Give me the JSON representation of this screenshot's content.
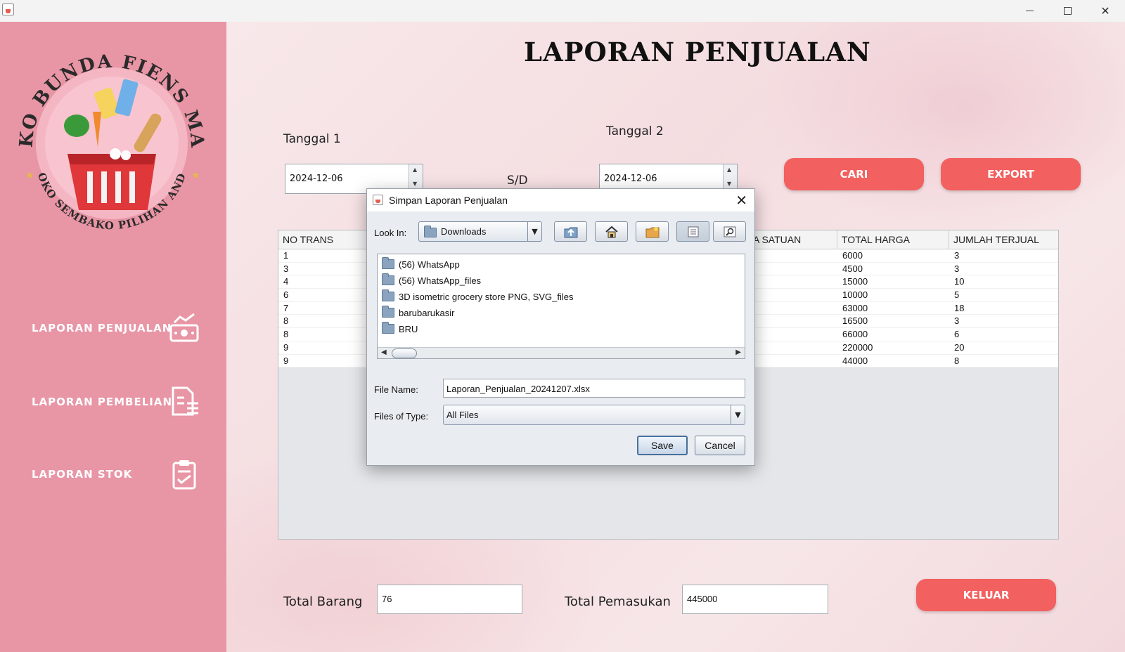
{
  "window": {
    "minimize_label": "—",
    "maximize_label": "□",
    "close_label": "✕"
  },
  "sidebar": {
    "logo_top_text": "TOKO BUNDA FIENS MART",
    "logo_bottom_text": "TOKO SEMBAKO PILIHAN ANDA",
    "items": [
      {
        "label": "LAPORAN PENJUALAN",
        "icon": "money-chart-icon"
      },
      {
        "label": "LAPORAN PEMBELIAN",
        "icon": "document-list-icon"
      },
      {
        "label": "LAPORAN STOK",
        "icon": "clipboard-check-icon"
      }
    ]
  },
  "main": {
    "title": "LAPORAN PENJUALAN",
    "date1_label": "Tanggal 1",
    "date1_value": "2024-12-06",
    "range_label": "S/D",
    "date2_label": "Tanggal 2",
    "date2_value": "2024-12-06",
    "search_button": "CARI",
    "export_button": "EXPORT",
    "exit_button": "KELUAR",
    "total_items_label": "Total Barang",
    "total_items_value": "76",
    "total_income_label": "Total Pemasukan",
    "total_income_value": "445000",
    "accent_color": "#f2605f"
  },
  "table": {
    "columns": [
      "NO TRANS",
      "A SATUAN",
      "TOTAL HARGA",
      "JUMLAH TERJUAL"
    ],
    "rows": [
      [
        "1",
        "6000",
        "3"
      ],
      [
        "3",
        "4500",
        "3"
      ],
      [
        "4",
        "15000",
        "10"
      ],
      [
        "6",
        "10000",
        "5"
      ],
      [
        "7",
        "63000",
        "18"
      ],
      [
        "8",
        "16500",
        "3"
      ],
      [
        "8",
        "66000",
        "6"
      ],
      [
        "9",
        "220000",
        "20"
      ],
      [
        "9",
        "44000",
        "8"
      ]
    ]
  },
  "dialog": {
    "title": "Simpan Laporan Penjualan",
    "close_label": "✕",
    "look_in_label": "Look In:",
    "look_in_value": "Downloads",
    "toolbar": [
      "up-folder-icon",
      "home-icon",
      "new-folder-icon",
      "list-view-icon",
      "details-view-icon"
    ],
    "files": [
      "(56) WhatsApp",
      "(56) WhatsApp_files",
      "3D isometric grocery store PNG, SVG_files",
      "barubarukasir",
      "BRU"
    ],
    "file_name_label": "File Name:",
    "file_name_value": "Laporan_Penjualan_20241207.xlsx",
    "file_type_label": "Files of Type:",
    "file_type_value": "All Files",
    "save_button": "Save",
    "cancel_button": "Cancel"
  }
}
